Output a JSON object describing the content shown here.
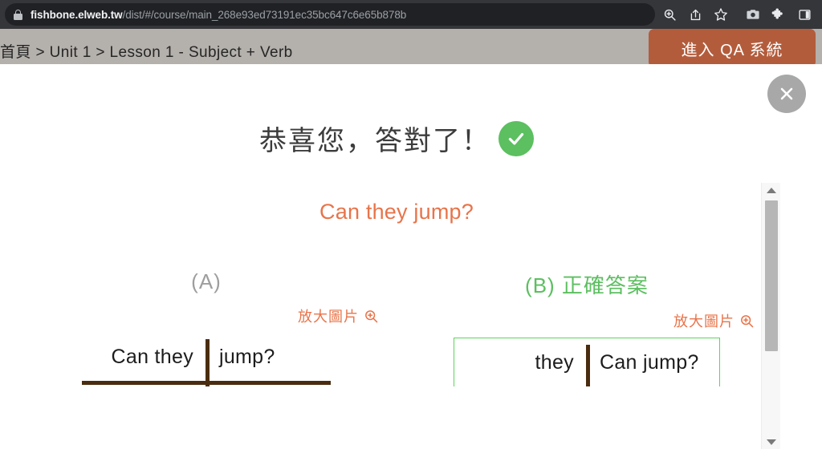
{
  "browser": {
    "url_host": "fishbone.elweb.tw",
    "url_path": "/dist/#/course/main_268e93ed73191ec35bc647c6e65b878b",
    "lock_icon": "lock-icon",
    "toolbar_icons": [
      {
        "name": "zoom-search-icon",
        "glyph": "search"
      },
      {
        "name": "share-icon",
        "glyph": "share"
      },
      {
        "name": "bookmark-star-icon",
        "glyph": "star"
      },
      {
        "name": "screenshot-camera-icon",
        "glyph": "camera"
      },
      {
        "name": "extensions-puzzle-icon",
        "glyph": "puzzle"
      },
      {
        "name": "side-panel-icon",
        "glyph": "panel"
      }
    ]
  },
  "page": {
    "breadcrumb": "首頁 > Unit 1 > Lesson 1 - Subject + Verb",
    "qa_button_label": "進入 QA 系統",
    "qa_button_color": "#b35c3c"
  },
  "modal": {
    "close_icon": "close-icon",
    "result_title": "恭喜您，答對了！",
    "result_icon": "check-circle-icon",
    "result_color": "#5cbf60",
    "question": "Can they jump?",
    "question_color": "#e8744a",
    "options": [
      {
        "label": "(A)",
        "label_color": "#9e9e9e",
        "is_correct": false,
        "zoom_link_label": "放大圖片",
        "zoom_icon": "zoom-in-icon",
        "diagram": {
          "left": "Can  they",
          "right": "jump?"
        }
      },
      {
        "label": "(B) 正確答案",
        "label_color": "#5cbf60",
        "is_correct": true,
        "zoom_link_label": "放大圖片",
        "zoom_icon": "zoom-in-icon",
        "diagram": {
          "left": "they",
          "right": "Can  jump?"
        }
      }
    ],
    "scrollbar": {
      "up_icon": "scroll-up-arrow-icon",
      "down_icon": "scroll-down-arrow-icon",
      "thumb": "scrollbar-thumb"
    }
  }
}
